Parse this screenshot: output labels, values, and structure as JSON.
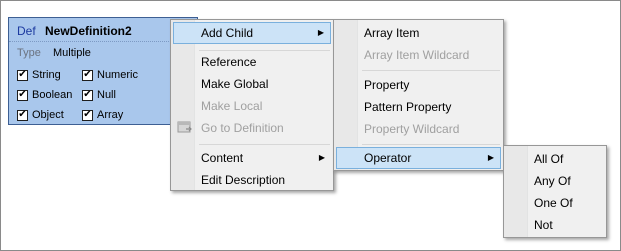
{
  "definition": {
    "keyword": "Def",
    "name": "NewDefinition2",
    "type_label": "Type",
    "type_value": "Multiple",
    "types": [
      {
        "label": "String",
        "checked": true
      },
      {
        "label": "Numeric",
        "checked": true
      },
      {
        "label": "Boolean",
        "checked": true
      },
      {
        "label": "Null",
        "checked": true
      },
      {
        "label": "Object",
        "checked": true
      },
      {
        "label": "Array",
        "checked": true
      }
    ]
  },
  "context_menu": {
    "items": [
      {
        "label": "Add Child",
        "submenu": true,
        "highlighted": true
      },
      {
        "label": "Reference"
      },
      {
        "label": "Make Global"
      },
      {
        "label": "Make Local",
        "disabled": true
      },
      {
        "label": "Go to Definition",
        "disabled": true,
        "icon": "go-to-definition-icon"
      },
      {
        "label": "Content",
        "submenu": true
      },
      {
        "label": "Edit Description"
      }
    ]
  },
  "add_child_menu": {
    "items": [
      {
        "label": "Array Item"
      },
      {
        "label": "Array Item Wildcard",
        "disabled": true
      },
      {
        "label": "Property"
      },
      {
        "label": "Pattern Property"
      },
      {
        "label": "Property Wildcard",
        "disabled": true
      },
      {
        "label": "Operator",
        "submenu": true,
        "highlighted": true
      }
    ]
  },
  "operator_menu": {
    "items": [
      {
        "label": "All Of"
      },
      {
        "label": "Any Of"
      },
      {
        "label": "One Of"
      },
      {
        "label": "Not"
      }
    ]
  },
  "colors": {
    "definition_bg": "#a9c7ec",
    "highlight_bg": "#cce3f7",
    "highlight_border": "#7ab0dd",
    "menu_bg": "#f0f0f0"
  }
}
